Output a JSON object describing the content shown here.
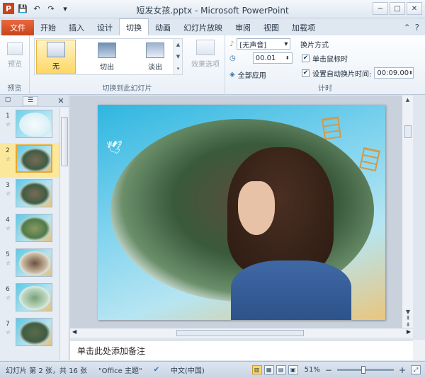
{
  "titlebar": {
    "title": "短发女孩.pptx - Microsoft PowerPoint",
    "qat": [
      "P",
      "💾",
      "↶",
      "↷",
      "▾"
    ],
    "controls": [
      "−",
      "□",
      "✕"
    ]
  },
  "tabs": {
    "file": "文件",
    "items": [
      "开始",
      "插入",
      "设计",
      "切换",
      "动画",
      "幻灯片放映",
      "审阅",
      "视图",
      "加载项"
    ],
    "active": "切换",
    "right": [
      "⌃",
      "?"
    ]
  },
  "ribbon": {
    "preview": {
      "label": "预览",
      "group": "预览"
    },
    "transitions": {
      "group": "切换到此幻灯片",
      "items": [
        "无",
        "切出",
        "淡出"
      ],
      "selected": "无",
      "effect_options": "效果选项"
    },
    "timing": {
      "sound_value": "[无声音]",
      "duration_value": "00.01",
      "apply_all": "全部应用",
      "advance_heading": "换片方式",
      "on_click_label": "单击鼠标时",
      "on_click_checked": true,
      "auto_label": "设置自动换片时间:",
      "auto_checked": true,
      "auto_value": "00:09.00",
      "group": "计时"
    }
  },
  "left_pane": {
    "tabs": [
      "▢",
      "☰",
      "✕"
    ],
    "slides": [
      {
        "num": "1",
        "star": "☆"
      },
      {
        "num": "2",
        "star": "☆"
      },
      {
        "num": "3",
        "star": "☆"
      },
      {
        "num": "4",
        "star": "☆"
      },
      {
        "num": "5",
        "star": "☆"
      },
      {
        "num": "6",
        "star": "☆"
      },
      {
        "num": "7",
        "star": "☆"
      }
    ],
    "selected_index": 1
  },
  "notes": {
    "placeholder": "单击此处添加备注"
  },
  "status": {
    "slide_info": "幻灯片 第 2 张，共 16 张",
    "theme": "\"Office 主题\"",
    "language": "中文(中国)",
    "zoom": "51%",
    "zoom_out": "−",
    "zoom_in": "+"
  },
  "colors": {
    "file_tab": "#d65225",
    "selected_slide": "#fce89a",
    "accent": "#ffd766"
  }
}
